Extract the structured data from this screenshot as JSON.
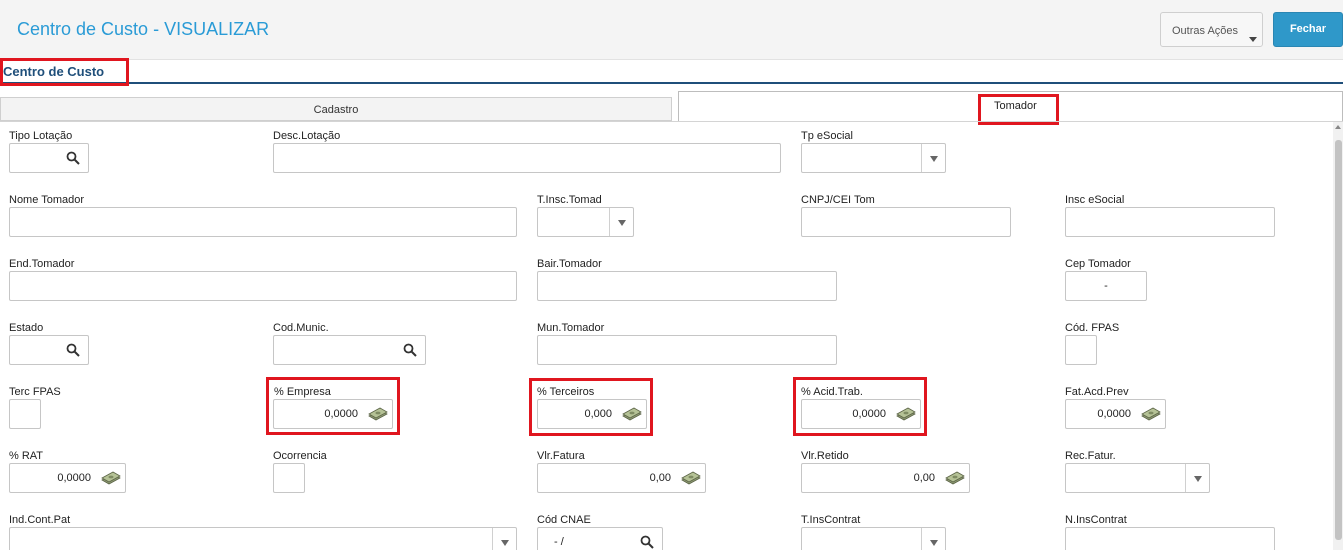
{
  "header": {
    "title": "Centro de Custo - VISUALIZAR",
    "outras_acoes": "Outras Ações",
    "fechar": "Fechar"
  },
  "section": {
    "title": "Centro de Custo"
  },
  "tabs": [
    {
      "label": "Cadastro",
      "active": false
    },
    {
      "label": "Tomador",
      "active": true
    }
  ],
  "fields": {
    "tipo_lotacao": {
      "label": "Tipo Lotação",
      "value": ""
    },
    "desc_lotacao": {
      "label": "Desc.Lotação",
      "value": ""
    },
    "tp_esocial": {
      "label": "Tp eSocial",
      "value": ""
    },
    "nome_tomador": {
      "label": "Nome Tomador",
      "value": ""
    },
    "t_insc_tomad": {
      "label": "T.Insc.Tomad",
      "value": ""
    },
    "cnpj_cei_tom": {
      "label": "CNPJ/CEI Tom",
      "value": ""
    },
    "insc_esocial": {
      "label": "Insc eSocial",
      "value": ""
    },
    "end_tomador": {
      "label": "End.Tomador",
      "value": ""
    },
    "bair_tomador": {
      "label": "Bair.Tomador",
      "value": ""
    },
    "cep_tomador": {
      "label": "Cep Tomador",
      "value": "-"
    },
    "estado": {
      "label": "Estado",
      "value": ""
    },
    "cod_munic": {
      "label": "Cod.Munic.",
      "value": ""
    },
    "mun_tomador": {
      "label": "Mun.Tomador",
      "value": ""
    },
    "cod_fpas": {
      "label": "Cód. FPAS",
      "value": ""
    },
    "terc_fpas": {
      "label": "Terc FPAS",
      "value": ""
    },
    "pct_empresa": {
      "label": "% Empresa",
      "value": "0,0000"
    },
    "pct_terceiros": {
      "label": "% Terceiros",
      "value": "0,000"
    },
    "pct_acid_trab": {
      "label": "% Acid.Trab.",
      "value": "0,0000"
    },
    "fat_acd_prev": {
      "label": "Fat.Acd.Prev",
      "value": "0,0000"
    },
    "pct_rat": {
      "label": "% RAT",
      "value": "0,0000"
    },
    "ocorrencia": {
      "label": "Ocorrencia",
      "value": ""
    },
    "vlr_fatura": {
      "label": "Vlr.Fatura",
      "value": "0,00"
    },
    "vlr_retido": {
      "label": "Vlr.Retido",
      "value": "0,00"
    },
    "rec_fatur": {
      "label": "Rec.Fatur.",
      "value": ""
    },
    "ind_cont_pat": {
      "label": "Ind.Cont.Pat",
      "value": ""
    },
    "cod_cnae": {
      "label": "Cód CNAE",
      "value": "- /"
    },
    "t_inscontrat": {
      "label": "T.InsContrat",
      "value": ""
    },
    "n_inscontrat": {
      "label": "N.InsContrat",
      "value": ""
    }
  },
  "colors": {
    "accent": "#2a9bd6",
    "highlight": "#e0161f",
    "button_primary": "#2f98c9",
    "section": "#1f4f7a"
  }
}
